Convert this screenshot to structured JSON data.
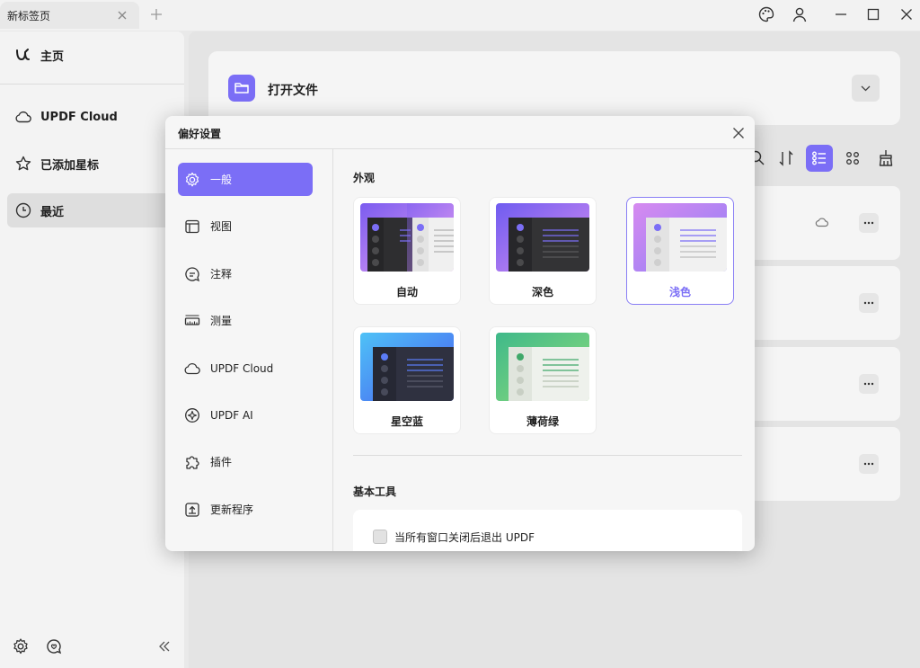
{
  "titlebar": {
    "tab_title": "新标签页",
    "icons": [
      "close-icon",
      "plus-icon",
      "palette-icon",
      "user-icon",
      "minimize-icon",
      "maximize-icon",
      "close-window-icon"
    ]
  },
  "sidebar": {
    "items": [
      {
        "label": "主页",
        "icon": "updf-logo-icon"
      },
      {
        "label": "UPDF Cloud",
        "icon": "cloud-icon"
      },
      {
        "label": "已添加星标",
        "icon": "star-icon"
      },
      {
        "label": "最近",
        "icon": "clock-icon"
      }
    ],
    "active_index": 3,
    "bottom_icons": [
      "settings-icon",
      "feedback-icon",
      "collapse-icon"
    ]
  },
  "main": {
    "open_file_label": "打开文件",
    "toolbar_icons": [
      "search-icon",
      "sort-icon",
      "list-view-icon",
      "grid-view-icon",
      "clean-icon"
    ],
    "selected_view": "list-view-icon"
  },
  "dialog": {
    "title": "偏好设置",
    "nav": [
      {
        "label": "一般",
        "icon": "gear-icon"
      },
      {
        "label": "视图",
        "icon": "view-icon"
      },
      {
        "label": "注释",
        "icon": "comment-icon"
      },
      {
        "label": "测量",
        "icon": "ruler-icon"
      },
      {
        "label": "UPDF Cloud",
        "icon": "cloud-icon"
      },
      {
        "label": "UPDF AI",
        "icon": "ai-icon"
      },
      {
        "label": "插件",
        "icon": "plugin-icon"
      },
      {
        "label": "更新程序",
        "icon": "update-icon"
      }
    ],
    "active_nav": 0,
    "appearance_title": "外观",
    "themes": [
      {
        "label": "自动",
        "key": "auto"
      },
      {
        "label": "深色",
        "key": "dark"
      },
      {
        "label": "浅色",
        "key": "light"
      },
      {
        "label": "星空蓝",
        "key": "blue"
      },
      {
        "label": "薄荷绿",
        "key": "green"
      }
    ],
    "selected_theme": "light",
    "basic_tools_title": "基本工具",
    "exit_option_label": "当所有窗口关闭后退出 UPDF",
    "exit_option_checked": false,
    "accent_color": "#7b6ef6"
  }
}
